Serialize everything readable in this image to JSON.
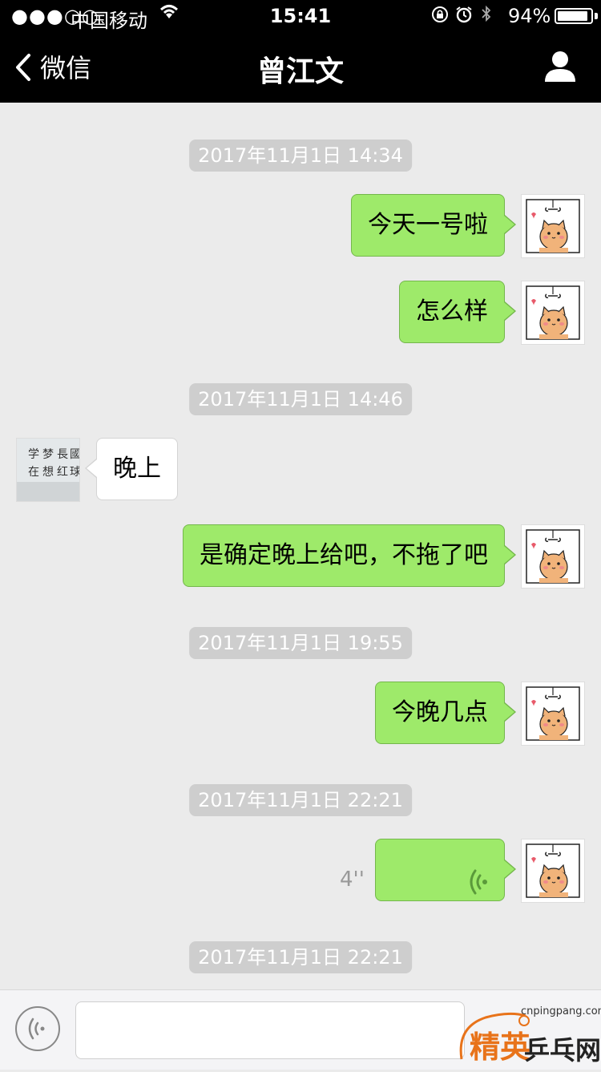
{
  "status_bar": {
    "signal": "●●●○○",
    "carrier": "中国移动",
    "time": "15:41",
    "battery_percent": "94%",
    "battery_level": 0.94
  },
  "nav": {
    "back_label": "微信",
    "title": "曾江文"
  },
  "timestamps": [
    "2017年11月1日 14:34",
    "2017年11月1日 14:46",
    "2017年11月1日 19:55",
    "2017年11月1日 22:21",
    "2017年11月1日 22:21"
  ],
  "messages": [
    {
      "from": "me",
      "text": "今天一号啦"
    },
    {
      "from": "me",
      "text": "怎么样"
    },
    {
      "from": "other",
      "text": "晚上"
    },
    {
      "from": "me",
      "text": "是确定晚上给吧，不拖了吧"
    },
    {
      "from": "me",
      "text": "今晚几点"
    },
    {
      "from": "me",
      "type": "voice",
      "duration": "4''"
    }
  ],
  "contact_avatar_text": [
    "学",
    "梦",
    "長",
    "國",
    "在",
    "想",
    "红",
    "球"
  ],
  "watermark": {
    "url": "cnpingpang.com",
    "brand": "精英",
    "name": "乒乓网"
  },
  "colors": {
    "my_bubble": "#9eea6a",
    "other_bubble": "#ffffff",
    "chat_bg": "#ebebeb",
    "nav_bg": "#000000"
  }
}
